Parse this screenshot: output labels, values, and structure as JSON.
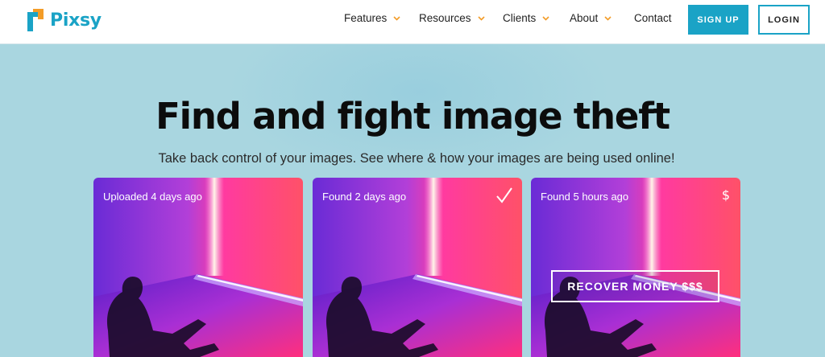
{
  "brand": {
    "name": "Pixsy",
    "primary_color": "#1aa3c6",
    "secondary_color": "#f39c27"
  },
  "nav": {
    "items": [
      {
        "label": "Features",
        "has_dropdown": true
      },
      {
        "label": "Resources",
        "has_dropdown": true
      },
      {
        "label": "Clients",
        "has_dropdown": true
      },
      {
        "label": "About",
        "has_dropdown": true
      },
      {
        "label": "Contact",
        "has_dropdown": false
      }
    ],
    "signup_label": "SIGN UP",
    "login_label": "LOGIN"
  },
  "hero": {
    "title": "Find and fight image theft",
    "subtitle": "Take back control of your images. See where & how your images are being used online!",
    "background_color": "#a9d6e0"
  },
  "cards": [
    {
      "label": "Uploaded 4 days ago"
    },
    {
      "label": "Found 2 days ago",
      "icon": "check-icon"
    },
    {
      "label": "Found 5 hours ago",
      "icon": "dollar-icon",
      "symbol": "$",
      "action_label": "RECOVER MONEY $$$"
    }
  ]
}
